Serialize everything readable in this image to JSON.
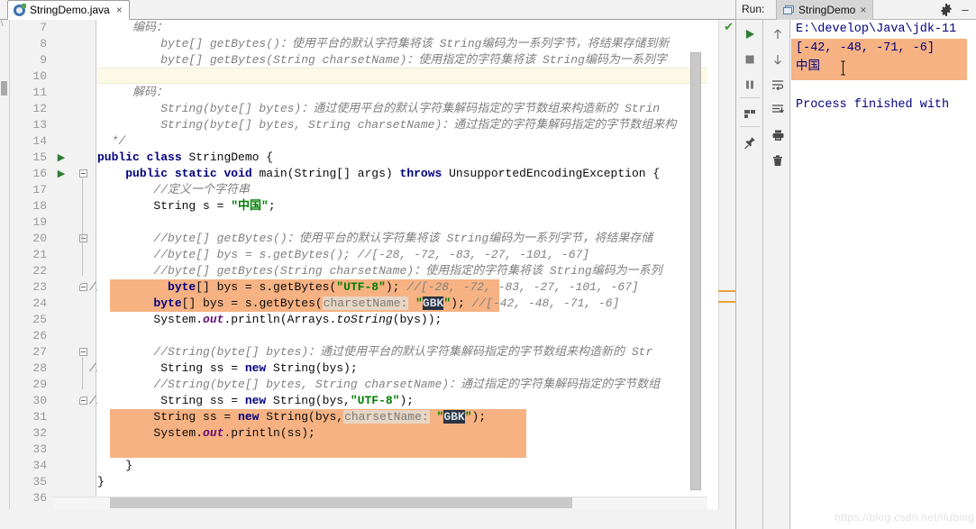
{
  "editor": {
    "tab": {
      "label": "StringDemo.java",
      "close": "×",
      "icon": "java-class-icon"
    },
    "first_line_number": 7,
    "lines": [
      {
        "num": 7,
        "text": "     编码："
      },
      {
        "num": 8,
        "text": "         byte[] getBytes()：使用平台的默认字符集将该 String编码为一系列字节，将结果存储到新"
      },
      {
        "num": 9,
        "text": "         byte[] getBytes(String charsetName)：使用指定的字符集将该 String编码为一系列字"
      },
      {
        "num": 10,
        "text": ""
      },
      {
        "num": 11,
        "text": "     解码："
      },
      {
        "num": 12,
        "text": "         String(byte[] bytes)：通过使用平台的默认字符集解码指定的字节数组来构造新的 Strin"
      },
      {
        "num": 13,
        "text": "         String(byte[] bytes, String charsetName)：通过指定的字符集解码指定的字节数组来构"
      },
      {
        "num": 14,
        "text": "  */"
      },
      {
        "num": 15,
        "text": "public class StringDemo {"
      },
      {
        "num": 16,
        "text": "    public static void main(String[] args) throws UnsupportedEncodingException {"
      },
      {
        "num": 17,
        "text": "        //定义一个字符串"
      },
      {
        "num": 18,
        "text": "        String s = \"中国\";"
      },
      {
        "num": 19,
        "text": ""
      },
      {
        "num": 20,
        "text": "        //byte[] getBytes()：使用平台的默认字符集将该 String编码为一系列字节，将结果存储"
      },
      {
        "num": 21,
        "text": "        //byte[] bys = s.getBytes(); //[-28, -72, -83, -27, -101, -67]"
      },
      {
        "num": 22,
        "text": "        //byte[] getBytes(String charsetName)：使用指定的字符集将该 String编码为一系列"
      },
      {
        "num": 23,
        "text": "          byte[] bys = s.getBytes(\"UTF-8\"); //[-28, -72, -83, -27, -101, -67]"
      },
      {
        "num": 24,
        "text": "        byte[] bys = s.getBytes( charsetName: \"GBK\"); //[-42, -48, -71, -6]"
      },
      {
        "num": 25,
        "text": "        System.out.println(Arrays.toString(bys));"
      },
      {
        "num": 26,
        "text": ""
      },
      {
        "num": 27,
        "text": "        //String(byte[] bytes)：通过使用平台的默认字符集解码指定的字节数组来构造新的 Str"
      },
      {
        "num": 28,
        "text": "         String ss = new String(bys);"
      },
      {
        "num": 29,
        "text": "        //String(byte[] bytes, String charsetName)：通过指定的字符集解码指定的字节数组"
      },
      {
        "num": 30,
        "text": "         String ss = new String(bys,\"UTF-8\");"
      },
      {
        "num": 31,
        "text": "        String ss = new String(bys, charsetName: \"GBK\");"
      },
      {
        "num": 32,
        "text": "        System.out.println(ss);"
      },
      {
        "num": 33,
        "text": ""
      },
      {
        "num": 34,
        "text": "    }"
      },
      {
        "num": 35,
        "text": "}"
      },
      {
        "num": 36,
        "text": ""
      }
    ],
    "caret_line": 10,
    "gutter_fold_comment": "//",
    "fold_comment_lines": [
      23,
      28,
      30
    ],
    "run_arrow_lines": [
      15,
      16
    ],
    "fold_mark_lines": [
      16,
      20,
      23,
      27,
      30
    ],
    "inspection_ok_icon": "checkmark-icon"
  },
  "run_panel": {
    "label": "Run:",
    "tab": {
      "label": "StringDemo",
      "close": "×",
      "icon": "run-config-icon"
    },
    "gear_icon": "gear-icon",
    "minimize_icon": "minimize-icon",
    "toolbar_left": [
      {
        "name": "rerun-button",
        "icon": "play-icon"
      },
      {
        "name": "stop-button",
        "icon": "stop-icon"
      },
      {
        "name": "pause-button",
        "icon": "pause-icon"
      },
      {
        "name": "layout-button",
        "icon": "layout-icon"
      },
      {
        "name": "pin-button",
        "icon": "pin-icon"
      }
    ],
    "toolbar_right": [
      {
        "name": "up-button",
        "icon": "arrow-up-icon"
      },
      {
        "name": "down-button",
        "icon": "arrow-down-icon"
      },
      {
        "name": "soft-wrap-button",
        "icon": "soft-wrap-icon"
      },
      {
        "name": "scroll-to-end-button",
        "icon": "scroll-end-icon"
      },
      {
        "name": "print-button",
        "icon": "print-icon"
      },
      {
        "name": "clear-all-button",
        "icon": "trash-icon"
      }
    ],
    "console": [
      "E:\\develop\\Java\\jdk-11",
      "[-42, -48, -71, -6]",
      "中国",
      "",
      "Process finished with"
    ]
  },
  "watermark": "https://blog.csdn.net/ifubing",
  "colors": {
    "highlight_orange": "#f6b283",
    "caret_line": "#fcf9e7",
    "keyword": "#000080",
    "comment": "#808080",
    "string": "#007f00",
    "field": "#660e7a",
    "param_hint_bg": "#e8d5c4",
    "selection_dark": "#2b3340"
  }
}
